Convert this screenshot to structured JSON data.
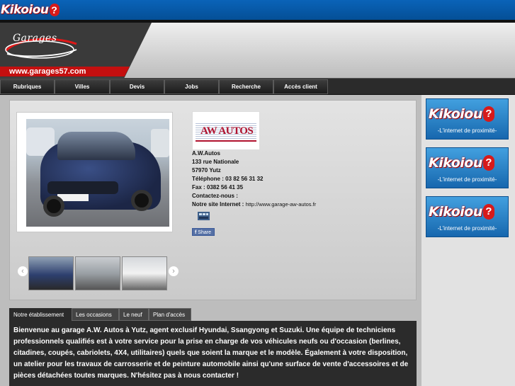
{
  "top": {
    "brand_text": "Kikoiou",
    "brand_mark": "?"
  },
  "header": {
    "logo_text": "Garages",
    "site_url": "www.garages57.com"
  },
  "nav": {
    "items": [
      {
        "label": "Rubriques"
      },
      {
        "label": "Villes"
      },
      {
        "label": "Devis"
      },
      {
        "label": "Jobs"
      },
      {
        "label": "Recherche"
      },
      {
        "label": "Accès client"
      }
    ]
  },
  "business": {
    "logo_text": "AW AUTOS",
    "name": "A.W.Autos",
    "address": "133 rue Nationale",
    "postal_city": "57970 Yutz",
    "telephone": "Téléphone : 03 82 56 31 32",
    "fax": "Fax : 0382 56 41 35",
    "contact": "Contactez-nous :",
    "website_label": "Notre site Internet :",
    "website_url": "http://www.garage-aw-autos.fr",
    "share_label": "Share"
  },
  "gallery": {
    "prev": "‹",
    "next": "›"
  },
  "tabs": [
    {
      "label": "Notre établissement"
    },
    {
      "label": "Les occasions"
    },
    {
      "label": "Le neuf"
    },
    {
      "label": "Plan d'accès"
    }
  ],
  "description": "Bienvenue au garage A.W. Autos à Yutz, agent exclusif Hyundai, Ssangyong et Suzuki. Une équipe de techniciens professionnels qualifiés est à votre service pour la prise en charge de vos véhicules neufs ou d'occasion (berlines, citadines, coupés, cabriolets, 4X4, utilitaires) quels que soient la marque et le modèle. Également à votre disposition, un atelier pour les travaux de carrosserie et de peinture automobile ainsi qu'une surface de vente d'accessoires et de pièces détachées toutes marques. N'hésitez pas à nous contacter !",
  "ads": [
    {
      "brand": "Kikoiou",
      "mark": "?",
      "tagline": "-L'internet de proximité-"
    },
    {
      "brand": "Kikoiou",
      "mark": "?",
      "tagline": "-L'internet de proximité-"
    },
    {
      "brand": "Kikoiou",
      "mark": "?",
      "tagline": "-L'internet de proximité-"
    }
  ],
  "colors": {
    "accent_blue": "#0a63b8",
    "accent_red": "#c40f0f",
    "nav_dark": "#2b2b2b"
  }
}
